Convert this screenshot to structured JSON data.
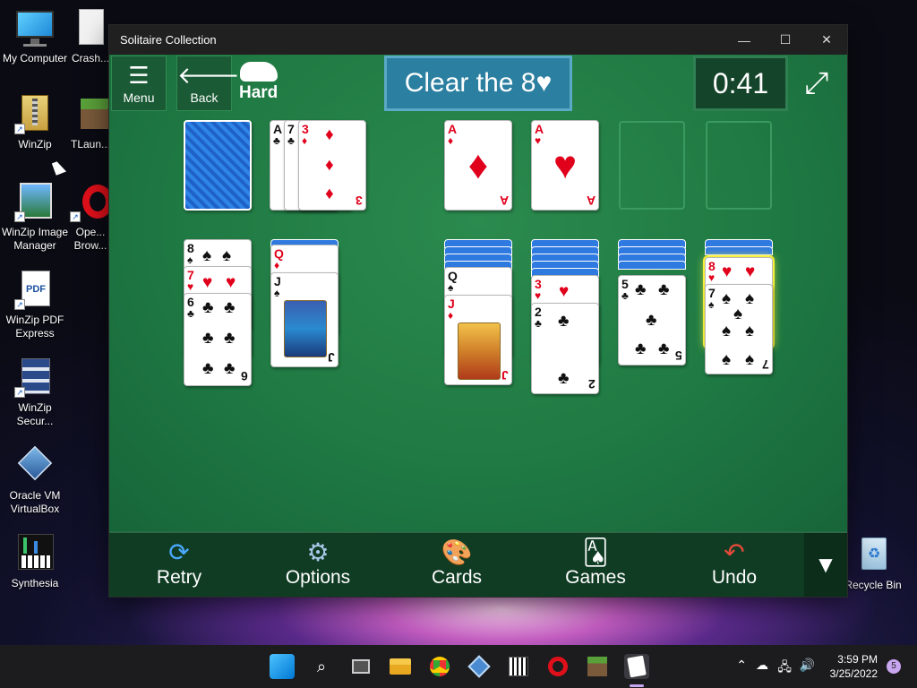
{
  "desktop": {
    "icons": [
      {
        "label": "My Computer"
      },
      {
        "label": "Crash..."
      },
      {
        "label": "WinZip"
      },
      {
        "label": "TLaun..."
      },
      {
        "label": "WinZip Image Manager"
      },
      {
        "label": "Ope... Brow..."
      },
      {
        "label": "WinZip PDF Express"
      },
      {
        "label": "WinZip Secur..."
      },
      {
        "label": "Oracle VM VirtualBox"
      },
      {
        "label": "Synthesia"
      },
      {
        "label": "Recycle Bin"
      }
    ]
  },
  "window": {
    "title": "Solitaire Collection",
    "controls": {
      "minimize": "—",
      "maximize": "☐",
      "close": "✕"
    }
  },
  "game": {
    "menu_label": "Menu",
    "back_label": "Back",
    "difficulty": "Hard",
    "goal": "Clear the 8♥",
    "timer": "0:41",
    "stock": {
      "count_visible": 1
    },
    "waste": [
      {
        "rank": "A",
        "suit": "♣",
        "color": "black"
      },
      {
        "rank": "7",
        "suit": "♣",
        "color": "black"
      },
      {
        "rank": "3",
        "suit": "♦",
        "color": "red"
      }
    ],
    "foundations": [
      {
        "rank": "A",
        "suit": "♦",
        "color": "red"
      },
      {
        "rank": "A",
        "suit": "♥",
        "color": "red"
      },
      {
        "rank": "",
        "suit": ""
      },
      {
        "rank": "",
        "suit": ""
      }
    ],
    "tableau": [
      {
        "cards": [
          {
            "rank": "8",
            "suit": "♠",
            "color": "black"
          },
          {
            "rank": "7",
            "suit": "♥",
            "color": "red"
          },
          {
            "rank": "6",
            "suit": "♣",
            "color": "black"
          }
        ]
      },
      {
        "cards": [
          {
            "rank": "Q",
            "suit": "♦",
            "color": "red"
          },
          {
            "rank": "J",
            "suit": "♠",
            "color": "black"
          }
        ]
      },
      {
        "cards": []
      },
      {
        "cards": [
          {
            "rank": "Q",
            "suit": "♠",
            "color": "black"
          },
          {
            "rank": "J",
            "suit": "♦",
            "color": "red"
          }
        ]
      },
      {
        "cards": [
          {
            "rank": "3",
            "suit": "♥",
            "color": "red"
          },
          {
            "rank": "2",
            "suit": "♣",
            "color": "black"
          }
        ]
      },
      {
        "cards": [
          {
            "rank": "5",
            "suit": "♣",
            "color": "black"
          }
        ]
      },
      {
        "cards": [
          {
            "rank": "8",
            "suit": "♥",
            "color": "red"
          },
          {
            "rank": "7",
            "suit": "♠",
            "color": "black"
          }
        ]
      }
    ]
  },
  "bottom_bar": {
    "retry": "Retry",
    "options": "Options",
    "cards": "Cards",
    "games": "Games",
    "undo": "Undo"
  },
  "taskbar": {
    "time": "3:59 PM",
    "date": "3/25/2022",
    "notifications": "5"
  },
  "colors": {
    "felt": "#1f7a43",
    "goal_bg": "#2b7fa0",
    "red_suit": "#e0001b",
    "highlight": "#f6ef3a"
  }
}
